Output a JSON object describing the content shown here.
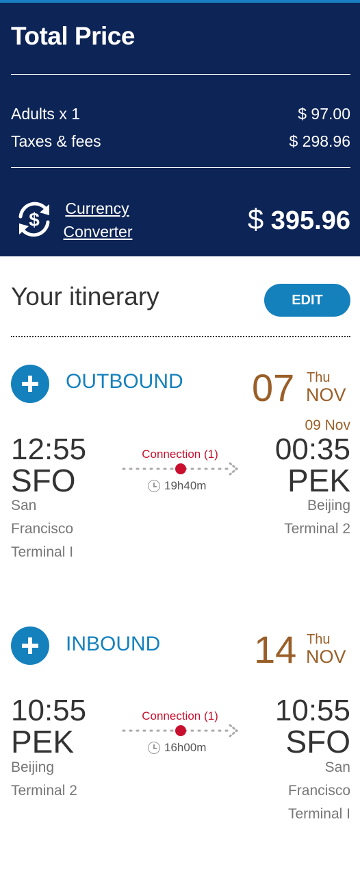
{
  "price": {
    "title": "Total Price",
    "adults_label": "Adults x 1",
    "adults_value": "$ 97.00",
    "taxes_label": "Taxes & fees",
    "taxes_value": "$ 298.96",
    "currency_link_line1": "Currency",
    "currency_link_line2": "Converter",
    "total_currency": "$",
    "total_amount": "395.96"
  },
  "itinerary": {
    "title": "Your itinerary",
    "edit_label": "EDIT"
  },
  "outbound": {
    "label": "OUTBOUND",
    "day": "07",
    "weekday": "Thu",
    "month": "NOV",
    "arrival_date": "09 Nov",
    "dep_time": "12:55",
    "dep_code": "SFO",
    "dep_city_line1": "San",
    "dep_city_line2": "Francisco",
    "dep_terminal": "Terminal I",
    "arr_time": "00:35",
    "arr_code": "PEK",
    "arr_city": "Beijing",
    "arr_terminal": "Terminal 2",
    "connection": "Connection (1)",
    "duration": "19h40m"
  },
  "inbound": {
    "label": "INBOUND",
    "day": "14",
    "weekday": "Thu",
    "month": "NOV",
    "dep_time": "10:55",
    "dep_code": "PEK",
    "dep_city": "Beijing",
    "dep_terminal": "Terminal 2",
    "arr_time": "10:55",
    "arr_code": "SFO",
    "arr_city_line1": "San",
    "arr_city_line2": "Francisco",
    "arr_terminal": "Terminal I",
    "connection": "Connection (1)",
    "duration": "16h00m"
  },
  "colors": {
    "panel_bg": "#0d2456",
    "accent_blue": "#1481bd",
    "date_brown": "#9a5f28",
    "connection_red": "#c8102e"
  },
  "icons": [
    "currency-exchange-icon",
    "plus-icon",
    "clock-icon",
    "route-arrow-icon"
  ]
}
